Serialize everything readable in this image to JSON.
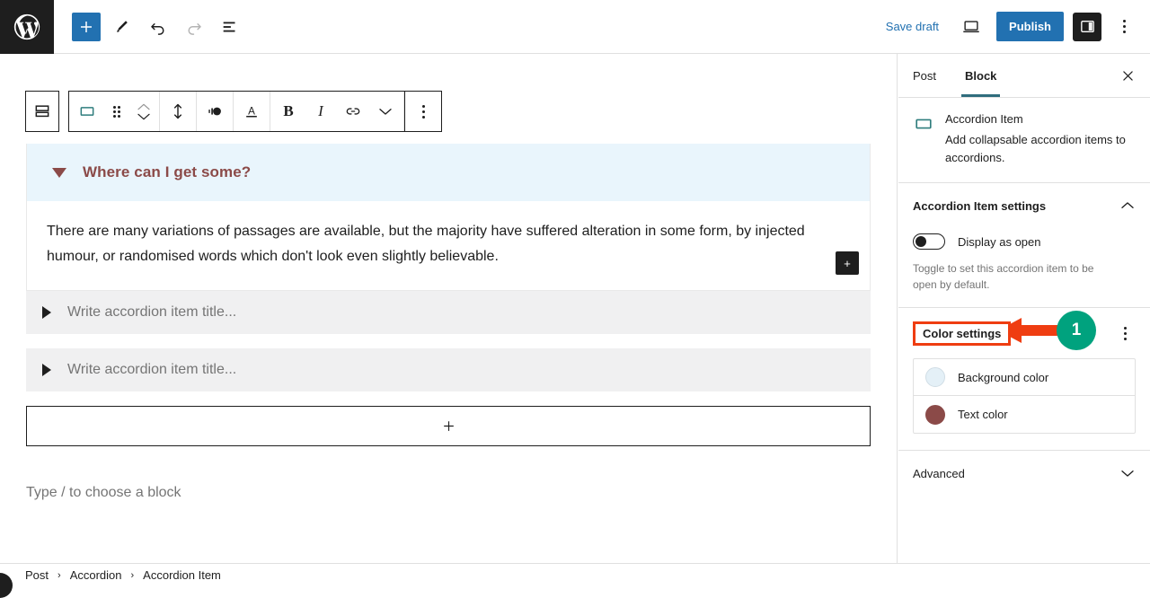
{
  "topbar": {
    "logo_icon": "wordpress-logo-icon",
    "add_block_label": "+",
    "add_block_icon": "plus-icon",
    "tools_icon": "pencil-edit-icon",
    "undo_icon": "undo-arrow-icon",
    "redo_icon": "redo-arrow-icon",
    "list_view_icon": "list-view-icon",
    "save_draft_label": "Save draft",
    "preview_icon": "desktop-preview-icon",
    "publish_label": "Publish",
    "settings_toggle_icon": "sidebar-panel-icon",
    "options_icon": "kebab-menu-icon"
  },
  "block_toolbar": {
    "parent_block_icon": "accordion-block-icon",
    "block_type_icon": "accordion-item-icon",
    "drag_icon": "drag-handle-icon",
    "move_up_icon": "chevron-up-icon",
    "move_down_icon": "chevron-down-icon",
    "height_icon": "vertical-resize-icon",
    "alignment_icon": "align-text-icon",
    "text_color_icon": "text-color-a-icon",
    "bold_label": "B",
    "italic_label": "I",
    "link_icon": "link-icon",
    "more_rich_text_icon": "chevron-down-icon",
    "options_icon": "kebab-menu-icon"
  },
  "editor": {
    "accordion_open_item": {
      "caret_icon": "caret-down-icon",
      "title": "Where can I get some?",
      "body": "There are many variations of passages are available, but the majority have suffered alteration in some form, by injected humour, or randomised words which don't look even slightly believable.",
      "inserter_label": "+",
      "header_bg_color": "#e9f5fc",
      "header_text_color": "#8b4a48"
    },
    "accordion_collapsed_items": [
      {
        "caret_icon": "caret-right-icon",
        "placeholder": "Write accordion item title..."
      },
      {
        "caret_icon": "caret-right-icon",
        "placeholder": "Write accordion item title..."
      }
    ],
    "append_button_label": "+",
    "default_paragraph_placeholder": "Type / to choose a block"
  },
  "sidebar": {
    "tabs": [
      {
        "label": "Post",
        "active": false
      },
      {
        "label": "Block",
        "active": true
      }
    ],
    "close_icon": "close-x-icon",
    "block_card": {
      "icon": "accordion-item-icon",
      "title": "Accordion Item",
      "description": "Add collapsable accordion items to accordions."
    },
    "settings_panel": {
      "title": "Accordion Item settings",
      "collapse_icon": "chevron-up-icon",
      "toggle": {
        "label": "Display as open",
        "state": "off"
      },
      "help_text": "Toggle to set this accordion item to be open by default."
    },
    "color_panel": {
      "title": "Color settings",
      "options_icon": "kebab-menu-icon",
      "rows": [
        {
          "label": "Background color",
          "swatch": "#e4f0f7",
          "swatch_border": "#d0dde5"
        },
        {
          "label": "Text color",
          "swatch": "#8b4a48",
          "swatch_border": "#8b4a48"
        }
      ]
    },
    "advanced_panel": {
      "title": "Advanced",
      "expand_icon": "chevron-down-icon"
    }
  },
  "annotation": {
    "badge_number": "1",
    "arrow_icon": "left-arrow-annotation-icon",
    "highlight_color": "#ef3d11",
    "badge_color": "#00a27e"
  },
  "breadcrumb": {
    "items": [
      "Post",
      "Accordion",
      "Accordion Item"
    ],
    "separator": "›"
  }
}
